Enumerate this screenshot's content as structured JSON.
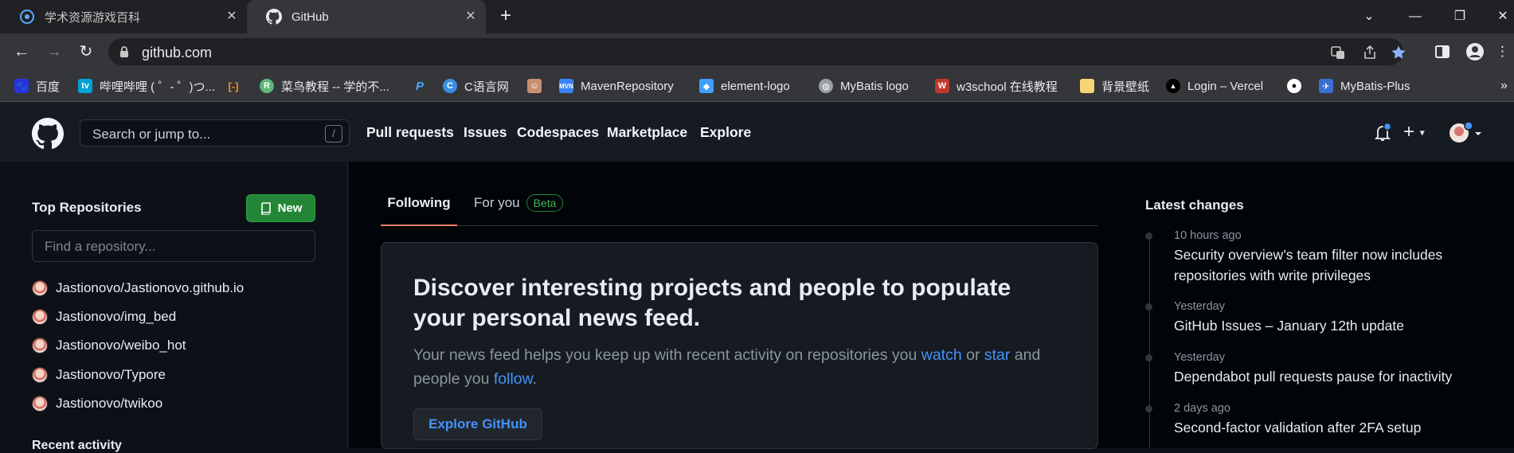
{
  "browser": {
    "tabs": [
      {
        "title": "学术资源游戏百科",
        "active": false
      },
      {
        "title": "GitHub",
        "active": true
      }
    ],
    "url": "github.com",
    "bookmarks": [
      {
        "label": "百度",
        "icon": "baidu-icon",
        "color": "#2932e1"
      },
      {
        "label": "哔哩哔哩 ( ゜- ゜)つ...",
        "icon": "bilibili-icon",
        "color": "#00a1d6"
      },
      {
        "label": "",
        "icon": "code-bracket-icon",
        "color": "#f08c28"
      },
      {
        "label": "菜鸟教程 -- 学的不...",
        "icon": "runoob-icon",
        "color": "#5fb878"
      },
      {
        "label": "",
        "icon": "p-icon",
        "color": "#4aa8ff"
      },
      {
        "label": "C语言网",
        "icon": "c-icon",
        "color": "#3a8ee6"
      },
      {
        "label": "",
        "icon": "avatar-bookmark-icon",
        "color": "#c99070"
      },
      {
        "label": "MavenRepository",
        "icon": "maven-icon",
        "color": "#3b82f6"
      },
      {
        "label": "element-logo",
        "icon": "element-icon",
        "color": "#409eff"
      },
      {
        "label": "MyBatis logo",
        "icon": "globe-icon",
        "color": "#9aa0a6"
      },
      {
        "label": "w3school 在线教程",
        "icon": "w3school-icon",
        "color": "#c0392b"
      },
      {
        "label": "背景壁纸",
        "icon": "folder-icon",
        "color": "#f5d572"
      },
      {
        "label": "Login – Vercel",
        "icon": "vercel-icon",
        "color": "#000000"
      },
      {
        "label": "",
        "icon": "github-icon",
        "color": "#ffffff"
      },
      {
        "label": "MyBatis-Plus",
        "icon": "mybatis-plus-icon",
        "color": "#3a6fd1"
      }
    ]
  },
  "header": {
    "search_placeholder": "Search or jump to...",
    "slash_hint": "/",
    "nav": [
      "Pull requests",
      "Issues",
      "Codespaces",
      "Marketplace",
      "Explore"
    ]
  },
  "sidebar": {
    "title": "Top Repositories",
    "new_label": "New",
    "find_placeholder": "Find a repository...",
    "repos": [
      "Jastionovo/Jastionovo.github.io",
      "Jastionovo/img_bed",
      "Jastionovo/weibo_hot",
      "Jastionovo/Typore",
      "Jastionovo/twikoo"
    ],
    "recent_title": "Recent activity"
  },
  "feed": {
    "tabs": {
      "following": "Following",
      "for_you": "For you",
      "beta": "Beta"
    },
    "heading": "Discover interesting projects and people to populate your personal news feed.",
    "text_1": "Your news feed helps you keep up with recent activity on repositories you ",
    "link_watch": "watch",
    "text_2": " or ",
    "link_star": "star",
    "text_3": " and people you ",
    "link_follow": "follow",
    "text_4": ".",
    "explore_label": "Explore GitHub"
  },
  "changes": {
    "title": "Latest changes",
    "items": [
      {
        "when": "10 hours ago",
        "what": "Security overview’s team filter now includes repositories with write privileges"
      },
      {
        "when": "Yesterday",
        "what": "GitHub Issues – January 12th update"
      },
      {
        "when": "Yesterday",
        "what": "Dependabot pull requests pause for inactivity"
      },
      {
        "when": "2 days ago",
        "what": "Second-factor validation after 2FA setup"
      }
    ]
  },
  "colors": {
    "accent_green": "#238636",
    "link_blue": "#4493f8",
    "tab_underline": "#f78166"
  }
}
